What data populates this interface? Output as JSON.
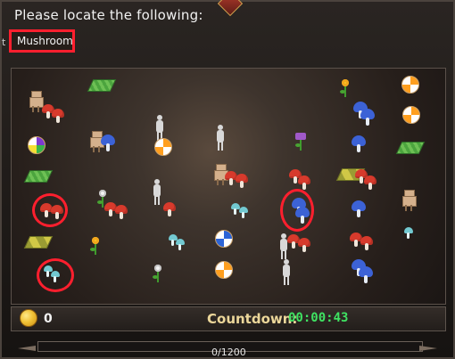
{
  "game": {
    "prompt": "Please locate the following:",
    "target": "Mushroom",
    "target_edge_char": "t",
    "coins": "0",
    "countdown_label": "Countdown:",
    "countdown_value": "00:00:43",
    "progress_text": "0/1200",
    "progress_ratio": 0
  },
  "colors": {
    "highlight": "#ff1f2e",
    "countdown_value": "#3fe262",
    "countdown_label": "#ecd79a"
  }
}
